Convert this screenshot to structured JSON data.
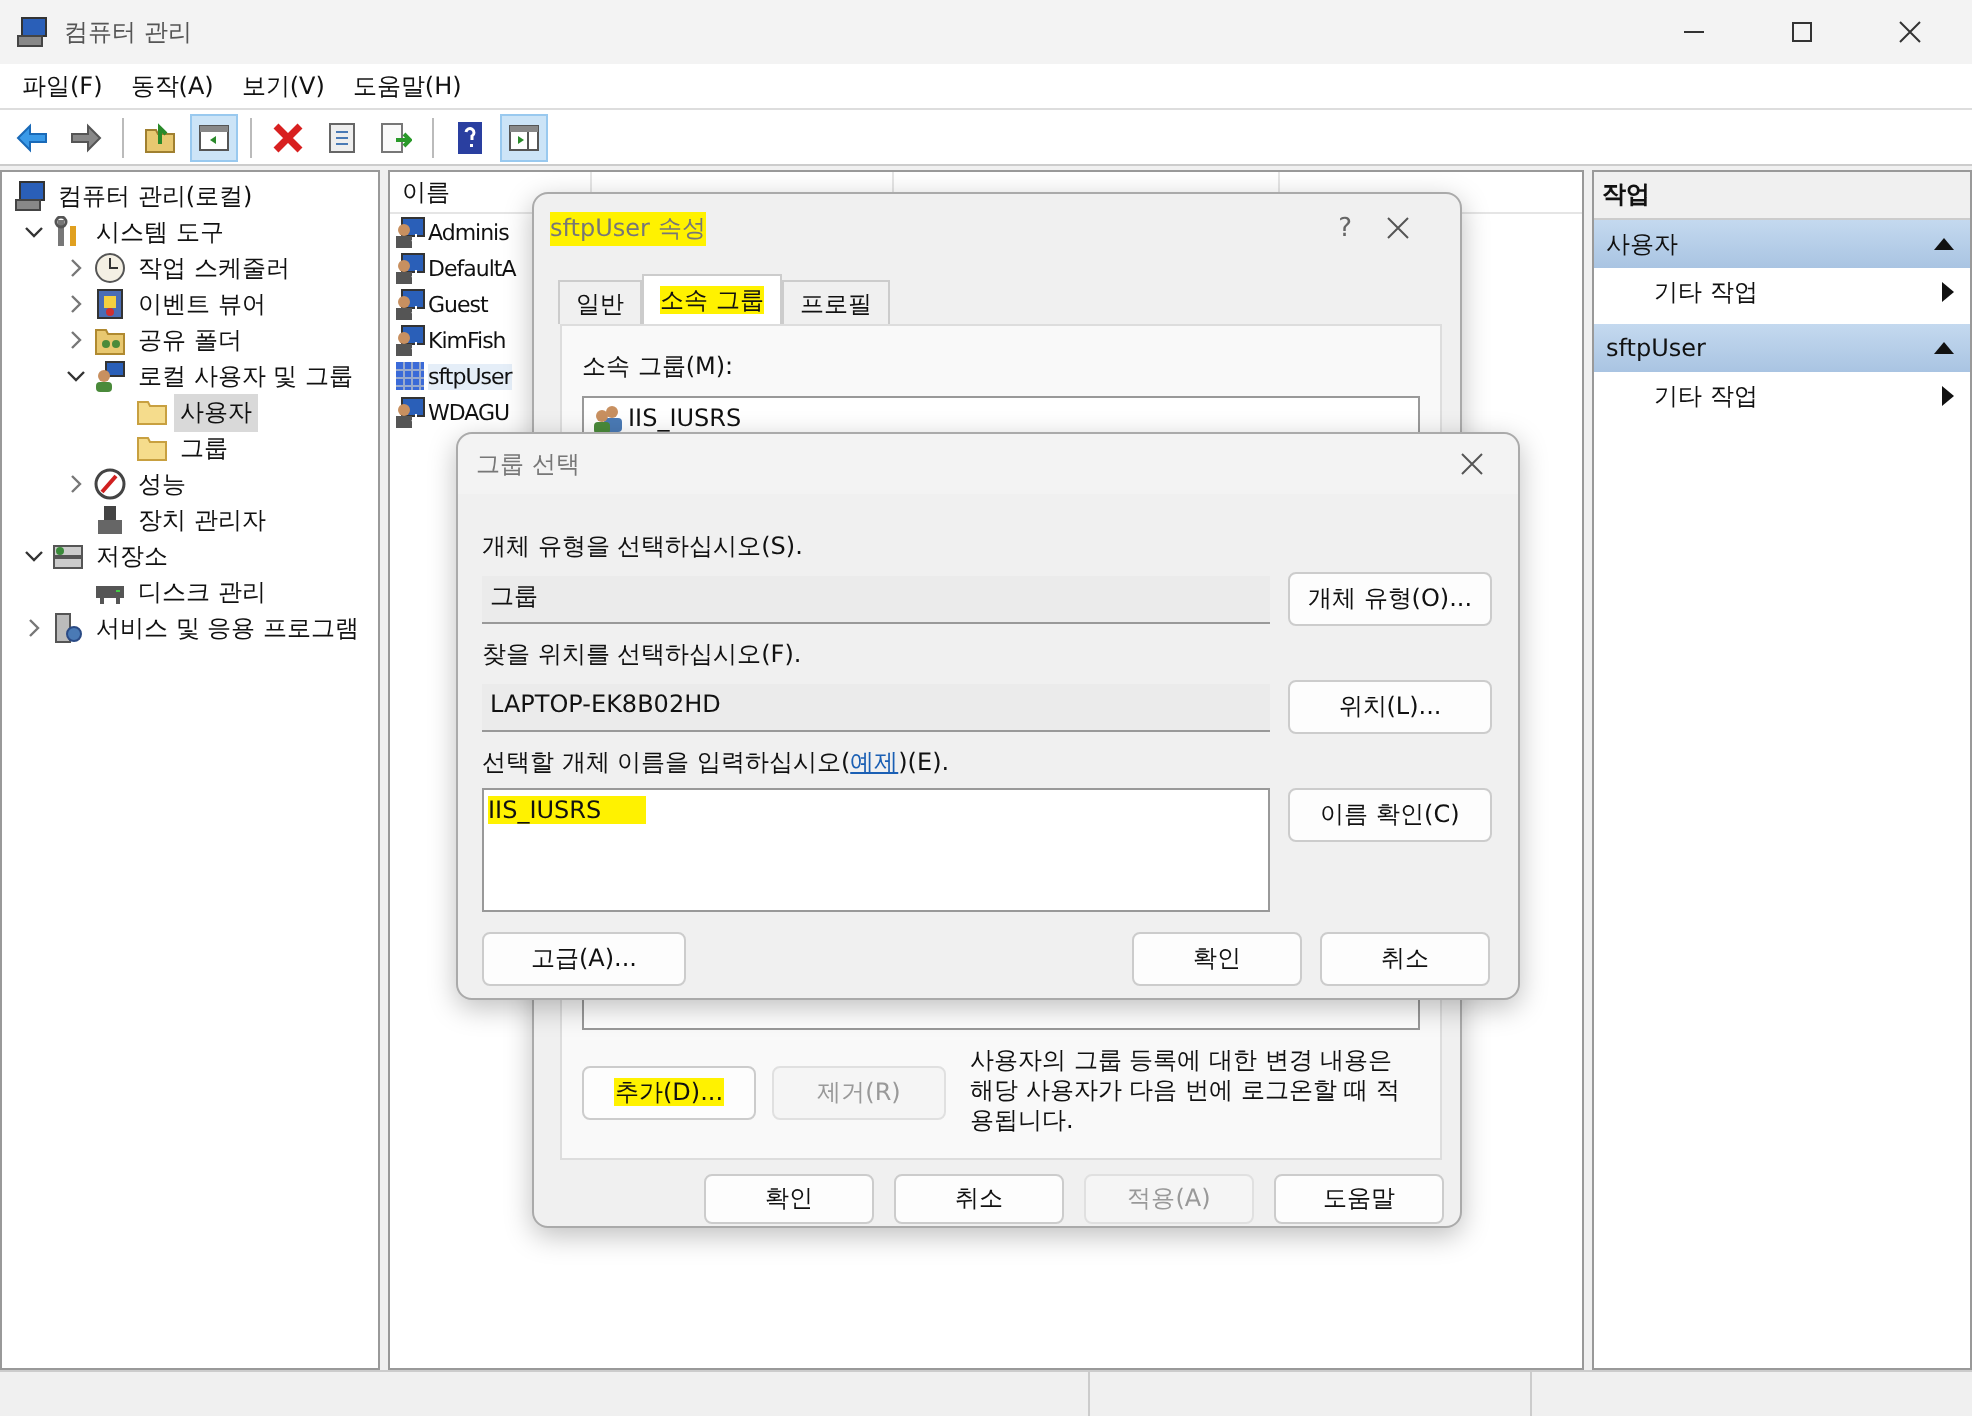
{
  "window": {
    "title": "컴퓨터 관리"
  },
  "menu": [
    "파일(F)",
    "동작(A)",
    "보기(V)",
    "도움말(H)"
  ],
  "toolbar": [
    {
      "kind": "back",
      "pressed": false
    },
    {
      "kind": "forward",
      "pressed": false
    },
    {
      "kind": "sep"
    },
    {
      "kind": "up",
      "pressed": false
    },
    {
      "kind": "tree",
      "pressed": true
    },
    {
      "kind": "sep"
    },
    {
      "kind": "delete",
      "pressed": false
    },
    {
      "kind": "properties",
      "pressed": false
    },
    {
      "kind": "export",
      "pressed": false
    },
    {
      "kind": "sep"
    },
    {
      "kind": "help",
      "pressed": false
    },
    {
      "kind": "pane",
      "pressed": true
    }
  ],
  "tree": [
    {
      "label": "컴퓨터 관리(로컬)",
      "kind": "computer",
      "selected": false,
      "children": [
        {
          "label": "시스템 도구",
          "kind": "tools",
          "expanded": true,
          "selected": false,
          "children": [
            {
              "label": "작업 스케줄러",
              "kind": "clock",
              "expanded": false,
              "selected": false
            },
            {
              "label": "이벤트 뷰어",
              "kind": "log",
              "expanded": false,
              "selected": false
            },
            {
              "label": "공유 폴더",
              "kind": "share",
              "expanded": false,
              "selected": false
            },
            {
              "label": "로컬 사용자 및 그룹",
              "kind": "users",
              "expanded": true,
              "selected": false,
              "children": [
                {
                  "label": "사용자",
                  "kind": "folder",
                  "selected": true
                },
                {
                  "label": "그룹",
                  "kind": "folder",
                  "selected": false
                }
              ]
            },
            {
              "label": "성능",
              "kind": "gauge",
              "expanded": false,
              "selected": false
            },
            {
              "label": "장치 관리자",
              "kind": "device",
              "selected": false
            }
          ]
        },
        {
          "label": "저장소",
          "kind": "storage",
          "expanded": true,
          "selected": false,
          "children": [
            {
              "label": "디스크 관리",
              "kind": "disk",
              "selected": false
            }
          ]
        },
        {
          "label": "서비스 및 응용 프로그램",
          "kind": "services",
          "expanded": false,
          "selected": false
        }
      ]
    }
  ],
  "list": {
    "columns": [
      "이름"
    ],
    "rows": [
      {
        "name": "Adminis",
        "selected": false
      },
      {
        "name": "DefaultA",
        "selected": false
      },
      {
        "name": "Guest",
        "selected": false
      },
      {
        "name": "KimFish",
        "selected": false
      },
      {
        "name": "sftpUser",
        "selected": true
      },
      {
        "name": "WDAGU",
        "selected": false
      }
    ]
  },
  "actions": {
    "title": "작업",
    "sections": [
      {
        "title": "사용자",
        "items": [
          "기타 작업"
        ]
      },
      {
        "title": "sftpUser",
        "items": [
          "기타 작업"
        ]
      }
    ]
  },
  "properties_dialog": {
    "title": "sftpUser 속성",
    "title_highlighted": true,
    "help": "?",
    "tabs": [
      {
        "label": "일반",
        "selected": false,
        "highlighted": false
      },
      {
        "label": "소속 그룹",
        "selected": true,
        "highlighted": true
      },
      {
        "label": "프로필",
        "selected": false,
        "highlighted": false
      }
    ],
    "member_label": "소속 그룹(M):",
    "members": [
      "IIS_IUSRS"
    ],
    "add": {
      "label": "추가(D)...",
      "disabled": false,
      "highlighted": true
    },
    "remove": {
      "label": "제거(R)",
      "disabled": true,
      "highlighted": false
    },
    "note": "사용자의 그룹 등록에 대한 변경 내용은 해당 사용자가 다음 번에 로그온할 때 적용됩니다.",
    "buttons": [
      {
        "label": "확인",
        "disabled": false
      },
      {
        "label": "취소",
        "disabled": false
      },
      {
        "label": "적용(A)",
        "disabled": true
      },
      {
        "label": "도움말",
        "disabled": false
      }
    ]
  },
  "select_dialog": {
    "title": "그룹 선택",
    "type_label": "개체 유형을 선택하십시오(S).",
    "type_value": "그룹",
    "type_button": "개체 유형(O)...",
    "location_label": "찾을 위치를 선택하십시오(F).",
    "location_value": "LAPTOP-EK8B02HD",
    "location_button": "위치(L)...",
    "names_label_before": "선택할 개체 이름을 입력하십시오(",
    "names_link": "예제",
    "names_label_after": ")(E).",
    "names_value": "IIS_IUSRS",
    "names_highlighted": true,
    "check_button": "이름 확인(C)",
    "advanced_button": "고급(A)...",
    "ok_button": "확인",
    "cancel_button": "취소"
  }
}
